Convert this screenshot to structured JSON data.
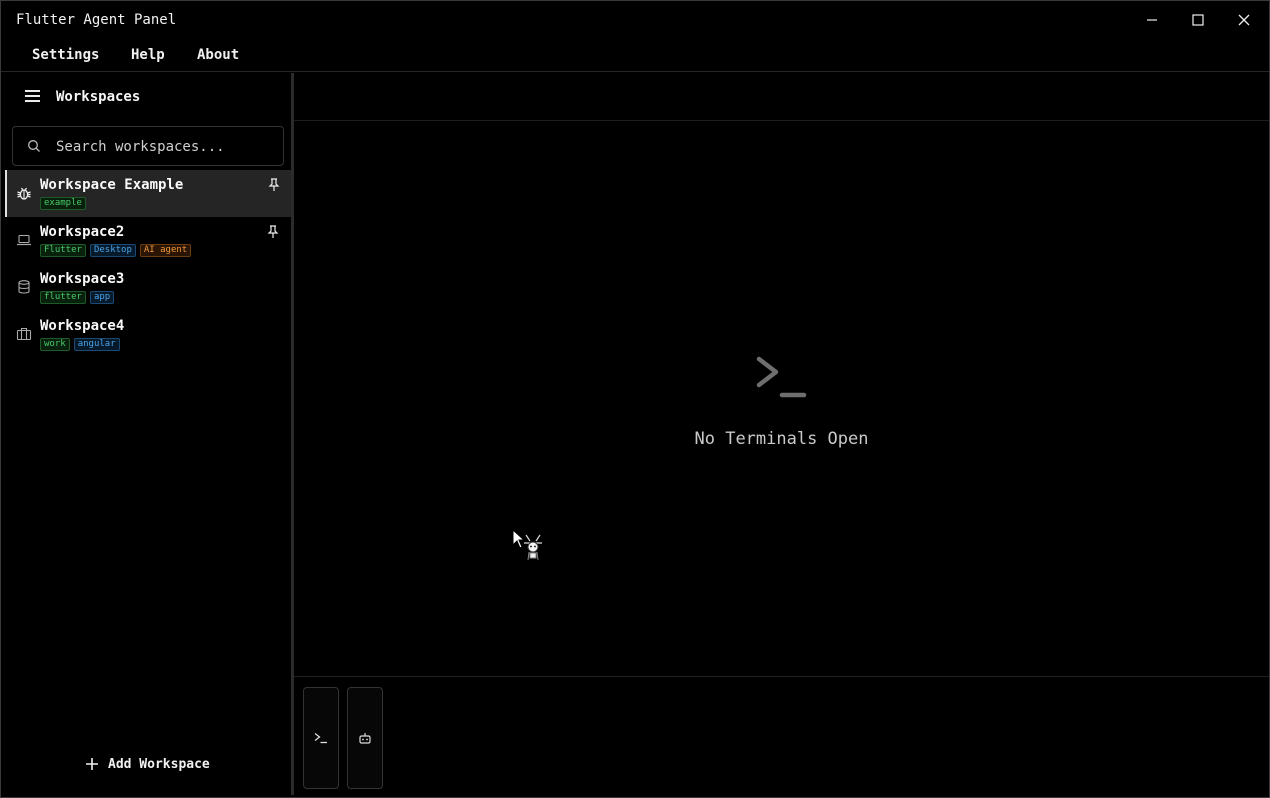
{
  "window": {
    "title": "Flutter Agent Panel"
  },
  "menu": {
    "items": [
      "Settings",
      "Help",
      "About"
    ]
  },
  "sidebar": {
    "title": "Workspaces",
    "search": {
      "placeholder": "Search workspaces...",
      "value": ""
    },
    "workspaces": [
      {
        "name": "Workspace Example",
        "icon": "bug-icon",
        "pinned": true,
        "active": true,
        "tags": [
          {
            "label": "example",
            "color": "green"
          }
        ]
      },
      {
        "name": "Workspace2",
        "icon": "laptop-icon",
        "pinned": true,
        "active": false,
        "tags": [
          {
            "label": "Flutter",
            "color": "green"
          },
          {
            "label": "Desktop",
            "color": "blue"
          },
          {
            "label": "AI agent",
            "color": "orange"
          }
        ]
      },
      {
        "name": "Workspace3",
        "icon": "database-icon",
        "pinned": false,
        "active": false,
        "tags": [
          {
            "label": "flutter",
            "color": "green"
          },
          {
            "label": "app",
            "color": "blue"
          }
        ]
      },
      {
        "name": "Workspace4",
        "icon": "briefcase-icon",
        "pinned": false,
        "active": false,
        "tags": [
          {
            "label": "work",
            "color": "green"
          },
          {
            "label": "angular",
            "color": "blue"
          }
        ]
      }
    ],
    "add_label": "Add Workspace"
  },
  "main": {
    "empty_state": "No Terminals Open",
    "tools": [
      "terminal-icon",
      "robot-icon"
    ]
  },
  "colors": {
    "tag_green": "#4cc96a",
    "tag_blue": "#4aa3e8",
    "tag_orange": "#f0963a",
    "background": "#000000"
  }
}
